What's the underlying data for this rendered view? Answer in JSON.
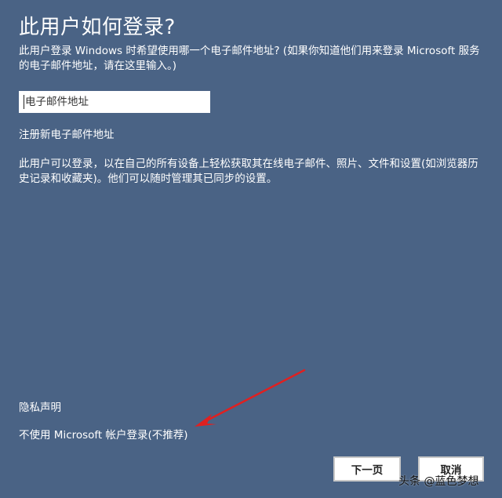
{
  "title": "此用户如何登录?",
  "description": "此用户登录 Windows 时希望使用哪一个电子邮件地址? (如果你知道他们用来登录 Microsoft 服务的电子邮件地址，请在这里输入。)",
  "email_field": {
    "placeholder": "电子邮件地址",
    "value": ""
  },
  "links": {
    "create_email": "注册新电子邮件地址",
    "privacy": "隐私声明",
    "no_microsoft_account": "不使用 Microsoft 帐户登录(不推荐)"
  },
  "info_text": "此用户可以登录，以在自己的所有设备上轻松获取其在线电子邮件、照片、文件和设置(如浏览器历史记录和收藏夹)。他们可以随时管理其已同步的设置。",
  "buttons": {
    "next": "下一页",
    "cancel": "取消"
  },
  "watermark": "头条 @蓝色梦想",
  "colors": {
    "background": "#4a6385",
    "annotation_arrow": "#e02020"
  },
  "annotation": {
    "icon": "red-arrow-icon"
  }
}
